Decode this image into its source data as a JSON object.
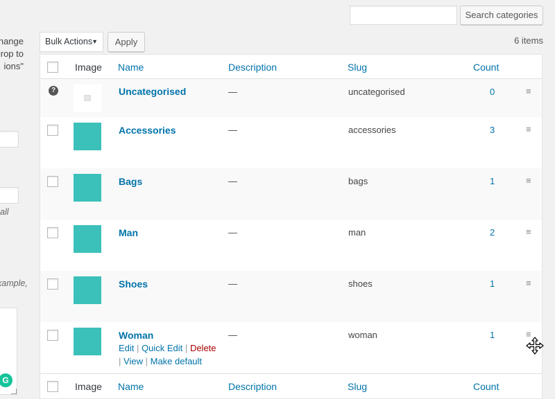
{
  "left_fragment": {
    "line1": "hange",
    "line2": "rop to",
    "line3": "ions\"",
    "hint1": "all",
    "hint2": "xample,"
  },
  "search": {
    "placeholder": "",
    "button_label": "Search categories"
  },
  "bulk": {
    "selected": "Bulk Actions",
    "apply_label": "Apply",
    "items_count": "6 items"
  },
  "columns": {
    "image": "Image",
    "name": "Name",
    "description": "Description",
    "slug": "Slug",
    "count": "Count"
  },
  "rows": [
    {
      "name": "Uncategorised",
      "description": "—",
      "slug": "uncategorised",
      "count": "0",
      "thumb": "placeholder"
    },
    {
      "name": "Accessories",
      "description": "—",
      "slug": "accessories",
      "count": "3",
      "thumb": "#3cc0ba"
    },
    {
      "name": "Bags",
      "description": "—",
      "slug": "bags",
      "count": "1",
      "thumb": "#3cc0ba"
    },
    {
      "name": "Man",
      "description": "—",
      "slug": "man",
      "count": "2",
      "thumb": "#3cc0ba"
    },
    {
      "name": "Shoes",
      "description": "—",
      "slug": "shoes",
      "count": "1",
      "thumb": "#3cc0ba"
    },
    {
      "name": "Woman",
      "description": "—",
      "slug": "woman",
      "count": "1",
      "thumb": "#3cc0ba"
    }
  ],
  "row_actions": {
    "edit": "Edit",
    "quick_edit": "Quick Edit",
    "delete": "Delete",
    "view": "View",
    "make_default": "Make default",
    "separator": "|"
  },
  "colors": {
    "link": "#0073aa",
    "delete": "#aa0000",
    "thumb_teal": "#3cc0ba"
  },
  "icons": {
    "help": "help-icon",
    "drag_handle": "drag-handle-icon",
    "move_cursor": "move-cursor-icon",
    "grammarly": "grammarly-icon"
  }
}
